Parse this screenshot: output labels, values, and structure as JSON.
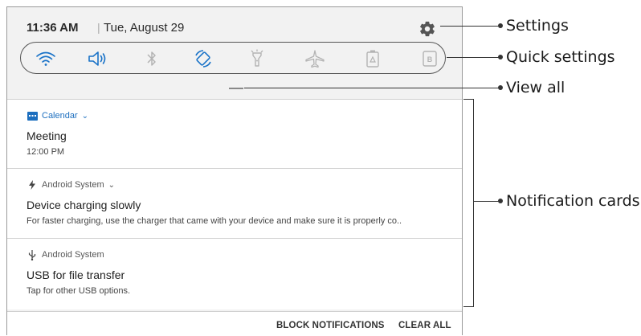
{
  "status": {
    "time": "11:36 AM",
    "separator": "|",
    "date": "Tue, August 29"
  },
  "quick_settings": {
    "icons": [
      "wifi-icon",
      "sound-icon",
      "bluetooth-icon",
      "auto-rotate-icon",
      "flashlight-icon",
      "airplane-mode-icon",
      "power-saving-icon",
      "blue-light-filter-icon"
    ],
    "active_color": "#1a73c8",
    "inactive_color": "#b3b3b3"
  },
  "notifications": [
    {
      "app": "Calendar",
      "app_icon": "calendar-icon",
      "app_color": "#1d6fbf",
      "title": "Meeting",
      "text": "12:00 PM",
      "expandable": true
    },
    {
      "app": "Android System",
      "app_icon": "bolt-icon",
      "app_color": "#555555",
      "title": "Device charging slowly",
      "text": "For faster charging, use the charger that came with your device and make sure it is properly co..",
      "expandable": true
    },
    {
      "app": "Android System",
      "app_icon": "usb-icon",
      "app_color": "#555555",
      "title": "USB for file transfer",
      "text": "Tap for other USB options.",
      "expandable": false
    }
  ],
  "actions": {
    "block": "BLOCK NOTIFICATIONS",
    "clear": "CLEAR ALL"
  },
  "callouts": {
    "settings": "Settings",
    "quick_settings": "Quick settings",
    "view_all": "View all",
    "notification_cards": "Notification cards"
  }
}
